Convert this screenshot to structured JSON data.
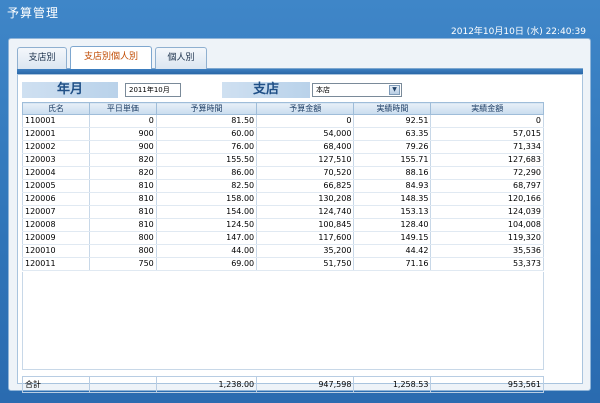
{
  "app": {
    "title": "予算管理",
    "datetime": "2012年10月10日 (水) 22:40:39"
  },
  "tabs": [
    {
      "label": "支店別"
    },
    {
      "label": "支店別個人別"
    },
    {
      "label": "個人別"
    }
  ],
  "filters": {
    "year_month_label": "年月",
    "year_month_value": "2011年10月",
    "branch_label": "支店",
    "branch_value": "本店"
  },
  "table": {
    "headers": [
      "氏名",
      "平日単価",
      "予算時間",
      "予算金額",
      "実績時間",
      "実績金額"
    ],
    "rows": [
      [
        "110001",
        "0",
        "81.50",
        "0",
        "92.51",
        "0"
      ],
      [
        "120001",
        "900",
        "60.00",
        "54,000",
        "63.35",
        "57,015"
      ],
      [
        "120002",
        "900",
        "76.00",
        "68,400",
        "79.26",
        "71,334"
      ],
      [
        "120003",
        "820",
        "155.50",
        "127,510",
        "155.71",
        "127,683"
      ],
      [
        "120004",
        "820",
        "86.00",
        "70,520",
        "88.16",
        "72,290"
      ],
      [
        "120005",
        "810",
        "82.50",
        "66,825",
        "84.93",
        "68,797"
      ],
      [
        "120006",
        "810",
        "158.00",
        "130,208",
        "148.35",
        "120,166"
      ],
      [
        "120007",
        "810",
        "154.00",
        "124,740",
        "153.13",
        "124,039"
      ],
      [
        "120008",
        "810",
        "124.50",
        "100,845",
        "128.40",
        "104,008"
      ],
      [
        "120009",
        "800",
        "147.00",
        "117,600",
        "149.15",
        "119,320"
      ],
      [
        "120010",
        "800",
        "44.00",
        "35,200",
        "44.42",
        "35,536"
      ],
      [
        "120011",
        "750",
        "69.00",
        "51,750",
        "71.16",
        "53,373"
      ]
    ],
    "total": [
      "合計",
      "",
      "1,238.00",
      "947,598",
      "1,258.53",
      "953,561"
    ]
  }
}
